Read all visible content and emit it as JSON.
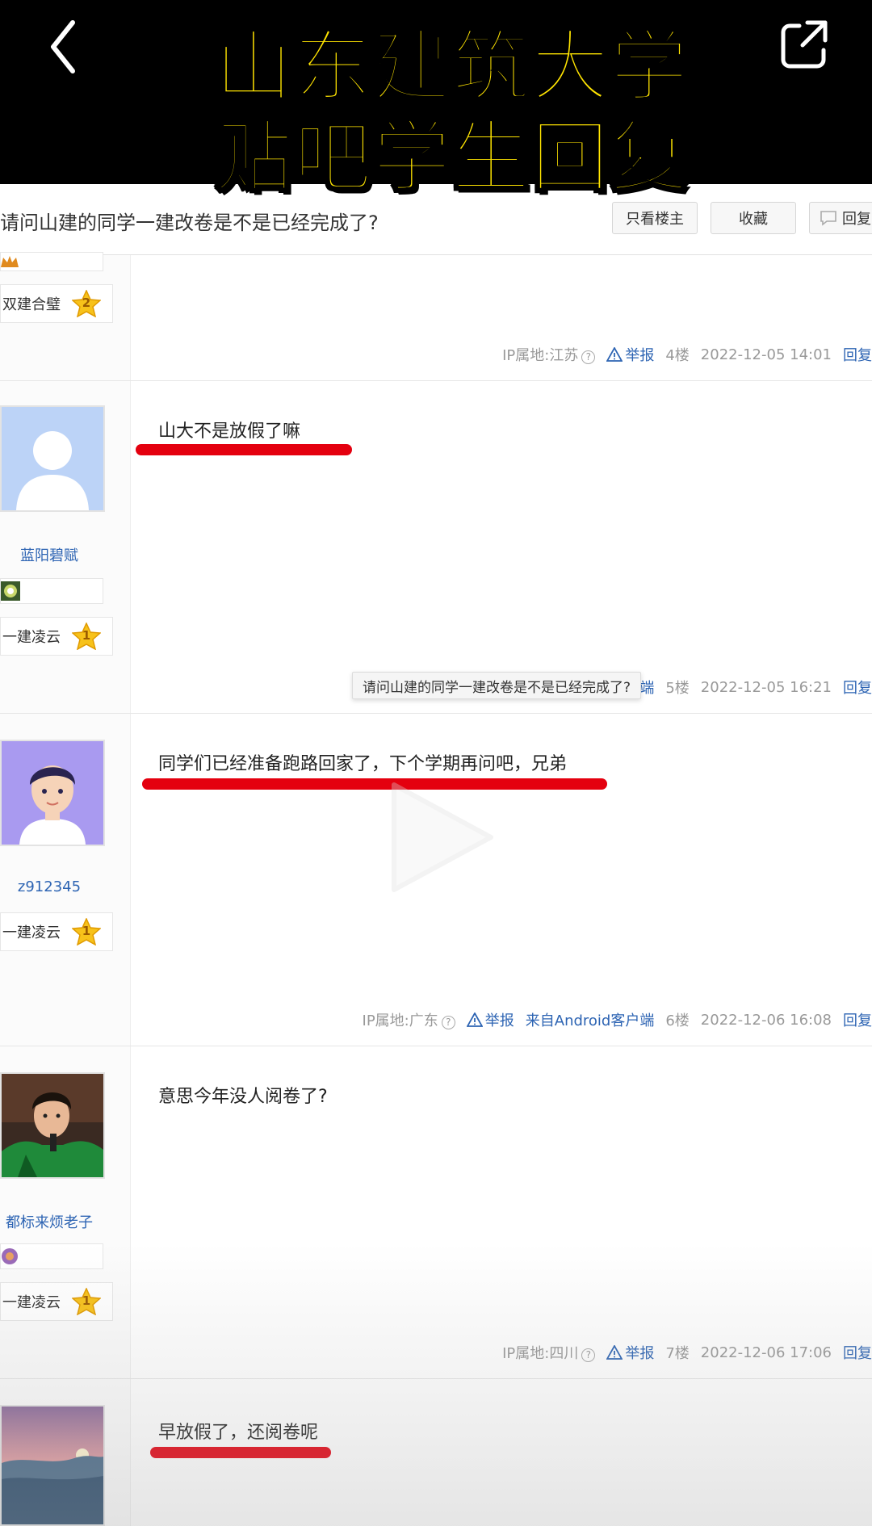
{
  "overlay": {
    "line1": "山东建筑大学",
    "line2": "贴吧学生回复"
  },
  "thread": {
    "title": "请问山建的同学一建改卷是不是已经完成了?",
    "only_op": "只看楼主",
    "favorite": "收藏",
    "reply": "回复"
  },
  "tooltip": "请问山建的同学一建改卷是不是已经完成了?",
  "floors": [
    {
      "level_name": "双建合璧",
      "level": "2",
      "ip": "IP属地:江苏",
      "report": "举报",
      "floor": "4楼",
      "time": "2022-12-05 14:01",
      "reply": "回复"
    },
    {
      "username": "蓝阳碧赋",
      "level_name": "一建凌云",
      "level": "1",
      "text": "山大不是放假了嘛",
      "client": "户端",
      "floor": "5楼",
      "time": "2022-12-05 16:21",
      "reply": "回复"
    },
    {
      "username": "z912345",
      "level_name": "一建凌云",
      "level": "1",
      "text": "同学们已经准备跑路回家了，下个学期再问吧，兄弟",
      "ip": "IP属地:广东",
      "report": "举报",
      "client": "来自Android客户端",
      "floor": "6楼",
      "time": "2022-12-06 16:08",
      "reply": "回复"
    },
    {
      "username": "都标来烦老子",
      "level_name": "一建凌云",
      "level": "1",
      "text": "意思今年没人阅卷了?",
      "ip": "IP属地:四川",
      "report": "举报",
      "floor": "7楼",
      "time": "2022-12-06 17:06",
      "reply": "回复"
    },
    {
      "text": "早放假了，还阅卷呢"
    }
  ],
  "colors": {
    "overlay_text": "#FFE400",
    "underline": "#e4000f",
    "link": "#2d64b3"
  },
  "icons": [
    "back-arrow-icon",
    "share-icon",
    "report-warning-icon",
    "question-icon",
    "level-star-icon",
    "play-icon",
    "comment-icon"
  ]
}
